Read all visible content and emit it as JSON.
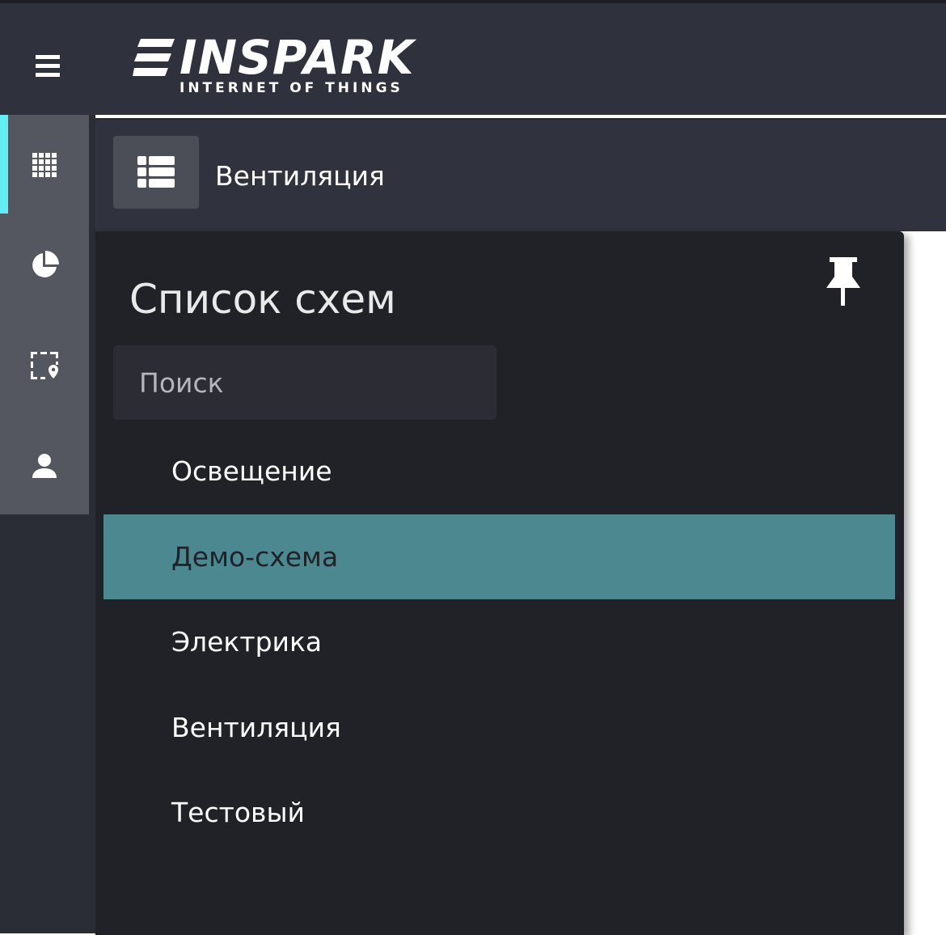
{
  "app": {
    "logo_text": "INSPARK",
    "logo_subtitle": "INTERNET OF THINGS"
  },
  "sidebar": {
    "items": [
      {
        "id": "dashboard",
        "icon": "grid-apps-icon",
        "active": true
      },
      {
        "id": "analytics",
        "icon": "pie-chart-icon",
        "active": false
      },
      {
        "id": "locations",
        "icon": "map-area-pin-icon",
        "active": false
      },
      {
        "id": "profile",
        "icon": "user-icon",
        "active": false
      }
    ],
    "accent_color": "#62eef2"
  },
  "header": {
    "toggle_icon": "list-icon",
    "title": "Вентиляция"
  },
  "panel": {
    "title": "Список схем",
    "pin_icon": "pin-icon",
    "search": {
      "placeholder": "Поиск",
      "value": ""
    },
    "schemes": [
      {
        "label": "Освещение",
        "selected": false
      },
      {
        "label": "Демо-схема",
        "selected": true
      },
      {
        "label": "Электрика",
        "selected": false
      },
      {
        "label": "Вентиляция",
        "selected": false
      },
      {
        "label": "Тестовый",
        "selected": false
      }
    ],
    "selected_color": "#4c8890"
  }
}
